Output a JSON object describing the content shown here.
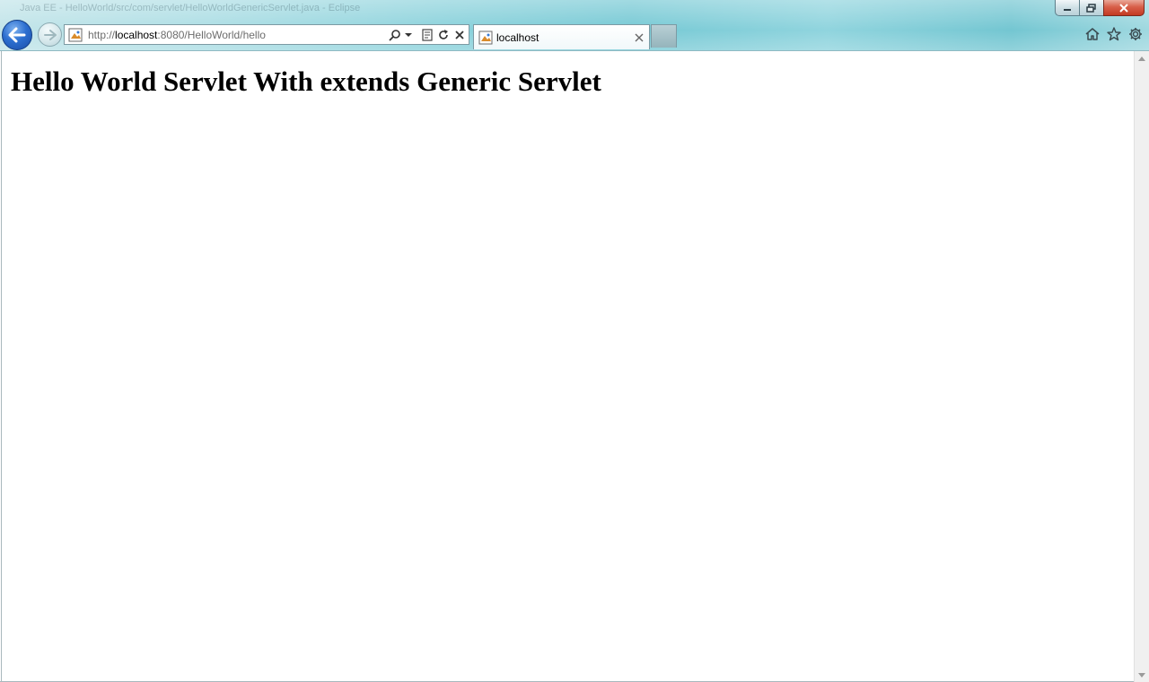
{
  "window": {
    "title": "Java EE - HelloWorld/src/com/servlet/HelloWorldGenericServlet.java - Eclipse"
  },
  "navigation": {
    "url_scheme": "http://",
    "url_host": "localhost",
    "url_rest": ":8080/HelloWorld/hello"
  },
  "tabs": [
    {
      "title": "localhost",
      "active": true
    }
  ],
  "page": {
    "heading": "Hello World Servlet With extends Generic Servlet"
  },
  "icons": {
    "back": "back-arrow-icon",
    "forward": "forward-arrow-icon",
    "search": "search-icon",
    "compat": "compatibility-view-icon",
    "refresh": "refresh-icon",
    "stop": "stop-icon",
    "home": "home-icon",
    "favorites": "star-icon",
    "tools": "gear-icon"
  },
  "colors": {
    "back_button": "#2c6fd0",
    "close_button": "#c23a22",
    "chrome": "#86d0da"
  }
}
